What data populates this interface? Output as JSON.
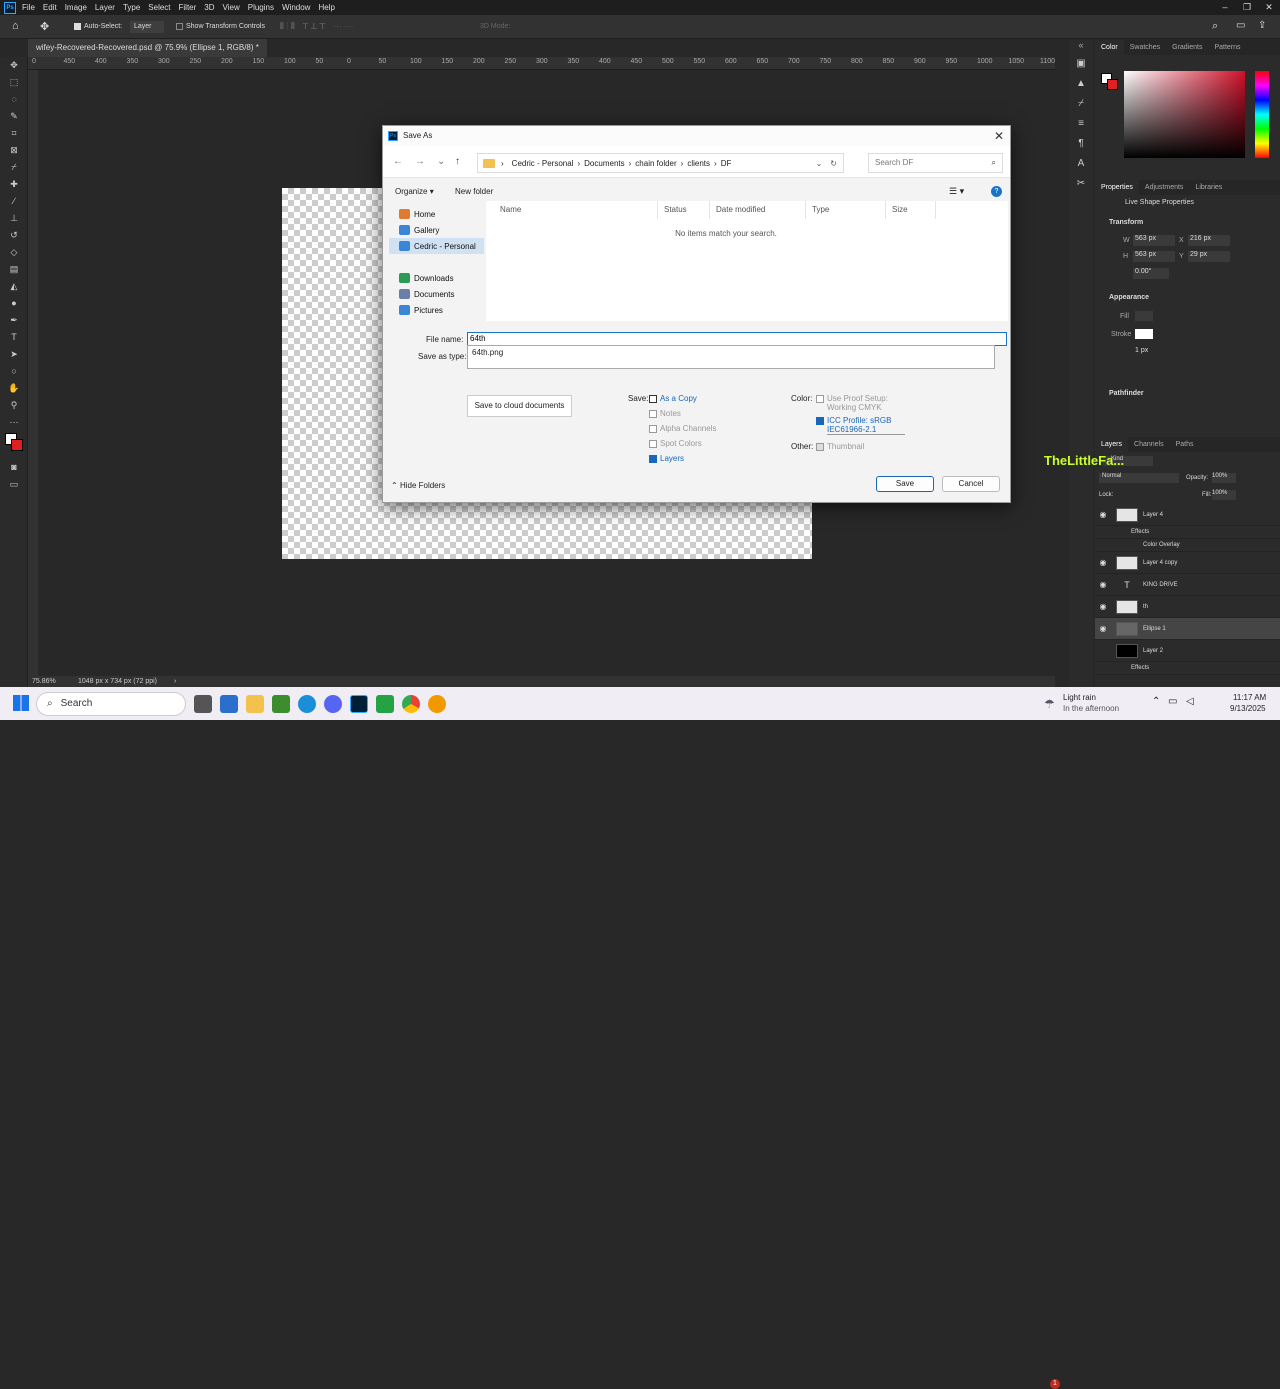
{
  "menubar": {
    "logo": "Ps",
    "items": [
      "File",
      "Edit",
      "Image",
      "Layer",
      "Type",
      "Select",
      "Filter",
      "3D",
      "View",
      "Plugins",
      "Window",
      "Help"
    ]
  },
  "options": {
    "auto_select": "Auto-Select:",
    "target": "Layer",
    "transform": "Show Transform Controls",
    "mode3d": "3D Mode:"
  },
  "document": {
    "tab": "wifey-Recovered-Recovered.psd @ 75.9% (Ellipse 1, RGB/8) *",
    "zoom": "75.86%",
    "dims": "1048 px x 734 px (72 ppi)"
  },
  "ruler": {
    "ticks": [
      "0",
      "450",
      "400",
      "350",
      "300",
      "250",
      "200",
      "150",
      "100",
      "50",
      "0",
      "50",
      "100",
      "150",
      "200",
      "250",
      "300",
      "350",
      "400",
      "450",
      "500",
      "550",
      "600",
      "650",
      "700",
      "750",
      "800",
      "850",
      "900",
      "950",
      "1000",
      "1050",
      "1100"
    ]
  },
  "dialog": {
    "title": "Save As",
    "close": "✕",
    "path": [
      "Cedric - Personal",
      "Documents",
      "chain folder",
      "clients",
      "DF"
    ],
    "search_placeholder": "Search DF",
    "organize": "Organize",
    "new_folder": "New folder",
    "nav": [
      {
        "label": "Home",
        "color": "#e07a2f"
      },
      {
        "label": "Gallery",
        "color": "#3a86d4"
      },
      {
        "label": "Cedric - Personal",
        "color": "#3a86d4"
      },
      {
        "label": "Downloads",
        "color": "#2c9a55"
      },
      {
        "label": "Documents",
        "color": "#6a7fa8"
      },
      {
        "label": "Pictures",
        "color": "#3a86d4"
      }
    ],
    "columns": [
      "Name",
      "Status",
      "Date modified",
      "Type",
      "Size"
    ],
    "empty": "No items match your search.",
    "file_name_label": "File name:",
    "file_name_value": "64th",
    "save_type_label": "Save as type:",
    "dropdown_option": "64th.png",
    "cloud_button": "Save to cloud documents",
    "save_label": "Save:",
    "save_options": [
      {
        "label": "As a Copy",
        "checked": false,
        "enabled": true
      },
      {
        "label": "Notes",
        "checked": false,
        "enabled": false
      },
      {
        "label": "Alpha Channels",
        "checked": false,
        "enabled": false
      },
      {
        "label": "Spot Colors",
        "checked": false,
        "enabled": false
      },
      {
        "label": "Layers",
        "checked": true,
        "enabled": true
      }
    ],
    "color_label": "Color:",
    "proof": "Use Proof Setup:",
    "proof2": "Working CMYK",
    "icc": "ICC Profile: sRGB",
    "icc2": "IEC61966-2.1",
    "other_label": "Other:",
    "thumbnail": "Thumbnail",
    "hide_folders": "Hide Folders",
    "save_btn": "Save",
    "cancel_btn": "Cancel"
  },
  "panels": {
    "color_tabs": [
      "Color",
      "Swatches",
      "Gradients",
      "Patterns"
    ],
    "props_tabs": [
      "Properties",
      "Adjustments",
      "Libraries"
    ],
    "live_shape": "Live Shape Properties",
    "transform": "Transform",
    "w_label": "W",
    "w": "563 px",
    "x_label": "X",
    "x": "216 px",
    "h_label": "H",
    "h": "563 px",
    "y_label": "Y",
    "y": "29 px",
    "angle": "0.00°",
    "appearance": "Appearance",
    "fill": "Fill",
    "stroke": "Stroke",
    "stroke_w": "1 px",
    "pathfinder": "Pathfinder",
    "layers_tabs": [
      "Layers",
      "Channels",
      "Paths"
    ],
    "kind": "Kind",
    "blend": "Normal",
    "opacity_label": "Opacity:",
    "opacity": "100%",
    "lock": "Lock:",
    "fill_label": "Fill:",
    "fill_val": "100%",
    "layers": [
      "Layer 4",
      "Effects",
      "Color Overlay",
      "Layer 4 copy",
      "KING DRIVE",
      "th",
      "Ellipse 1",
      "Layer 2",
      "Effects"
    ],
    "watermark": "TheLittleFa..."
  },
  "taskbar": {
    "search": "Search",
    "weather": "Light rain",
    "weather2": "In the afternoon",
    "time": "11:17 AM",
    "date": "9/13/2025",
    "notif": "1"
  },
  "colors": {
    "fg": "#ffffff",
    "bg": "#e02020",
    "accent": "#1a66b8"
  }
}
